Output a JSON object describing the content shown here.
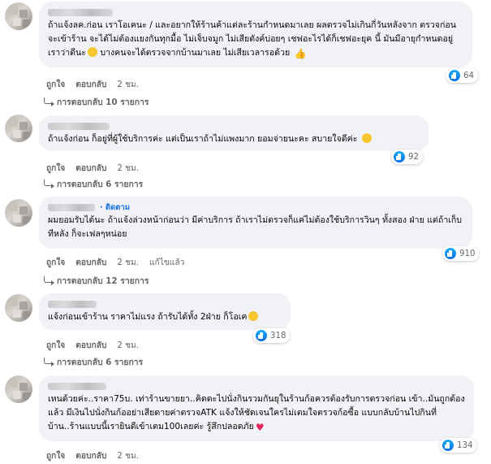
{
  "colors": {
    "bubble": "#f0f2f5",
    "secondary_text": "#65676b",
    "link_blue": "#1b74e4",
    "like_blue": "#1877f2"
  },
  "icons": {
    "like": "like-icon",
    "reply": "reply-arrow-icon"
  },
  "comments": [
    {
      "text": "ถ้าแจ้งลค.ก่อน เราโอเคนะ / และอยากให้ร้านค้าแต่ละร้านกำหนดมาเลย ผลตรวจไม่เกินกี่วันหลังจาก ตรวจก่อนจะเข้าร้าน จะได้ไม่ต้องแยงกันทุกมื้อ ไม่เจ็บจมูก ไม่เสียตังค์บ่อยๆ เชฟอะไรได้ก็เชฟอะยุค นี้ มันมีอายุกำหนดอยู่ เราว่าดีนะ",
      "text_tail": " บางคนจะได้ตรวจจากบ้านมาเลย ไม่เสียเวลารอด้วย",
      "like_label": "ถูกใจ",
      "reply_label": "ตอบกลับ",
      "time": "2 ชม.",
      "reactions": "64",
      "replies_label": "การตอบกลับ 10 รายการ"
    },
    {
      "text": "ถ้าแจ้งก่อน ก็อยู่ที่ผู้ใช้บริการค่ะ แต่เป็นเราถ้าไม่แพงมาก ยอมจ่ายนะคะ สบายใจดีค่ะ",
      "like_label": "ถูกใจ",
      "reply_label": "ตอบกลับ",
      "time": "2 ชม.",
      "reactions": "92",
      "replies_label": "การตอบกลับ 6 รายการ"
    },
    {
      "follow_label": "· ติดตาม",
      "text": "ผมยอมรับได้นะ ถ้าแจ้งล่วงหน้าก่อนว่า มีค่าบริการ ถ้าเราไม่ตรวจก็แค่ไม่ต้องใช้บริการวินๆ ทั้งสอง ฝ่าย แต่ถ้าเก็บทีหลัง ก็จะเฟลๆหน่อย",
      "like_label": "ถูกใจ",
      "reply_label": "ตอบกลับ",
      "time": "2 ชม.",
      "edited_label": "แก้ไขแล้ว",
      "reactions": "910",
      "replies_label": "การตอบกลับ 12 รายการ"
    },
    {
      "text": "แจ้งก่อนเข้าร้าน ราคาไม่แรง ถ้ารับได้ทั้ง 2ฝ่าย ก็โอเค",
      "like_label": "ถูกใจ",
      "reply_label": "ตอบกลับ",
      "time": "2 ชม.",
      "reactions": "318",
      "replies_label": "การตอบกลับ 6 รายการ"
    },
    {
      "text": "เหนด้วยค่ะ..ราคา75บ. เท่าร้านขายยา..คิดดะไปนั่งกินรวมกันยุในร้านก้อควรต้องรับการตรวจก่อน เข้า..มันถูกต้องแล้ว มีเงินไปนั่งกินก้ออย่าเสียดายค่าตรวจATK แจ้งให้ชัดเจนใครไม่เตมใจตรวจก้อซื้อ แบบกลับบ้านไปกินที่บ้าน..ร้านแบบนี้เรายินดีเข้าเตม100เลยค่ะ รู้สึกปลอดภัย",
      "like_label": "ถูกใจ",
      "reply_label": "ตอบกลับ",
      "time": "2 ชม.",
      "reactions": "134"
    }
  ]
}
